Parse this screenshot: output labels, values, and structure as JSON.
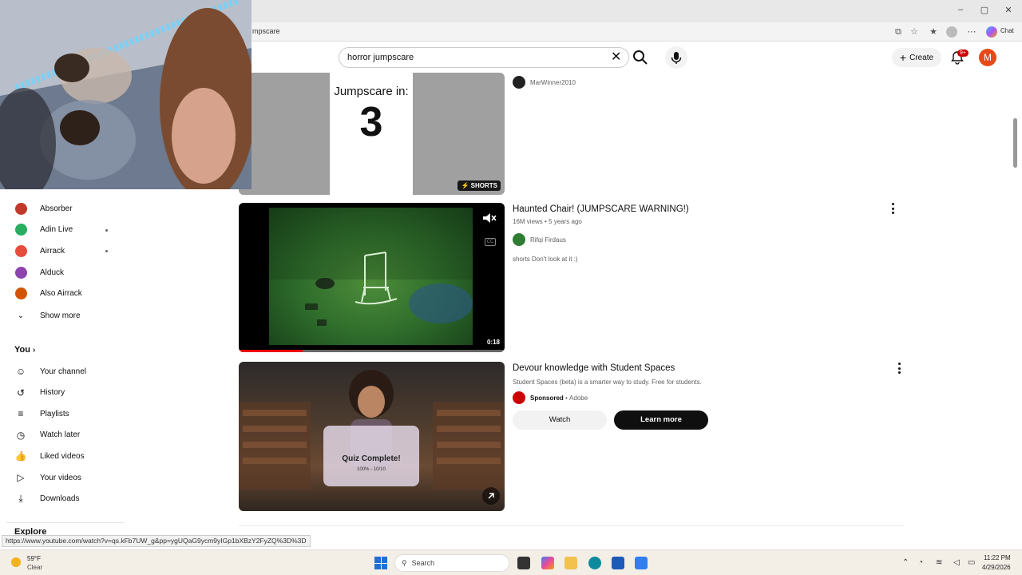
{
  "browser": {
    "url_fragment": "mpscare",
    "status_url": "https://www.youtube.com/watch?v=qs.kFb7UW_g&pp=ygUQaG9ycm9yIGp1bXBzY2FyZQ%3D%3D",
    "profile_label": "Chat"
  },
  "header": {
    "search_value": "horror jumpscare",
    "create_label": "Create",
    "notifications_badge": "9+",
    "avatar_letter": "M"
  },
  "sidebar": {
    "subscriptions": [
      {
        "name": "Absorber",
        "color": "#c0392b",
        "live": false
      },
      {
        "name": "Adin Live",
        "color": "#27ae60",
        "live": true
      },
      {
        "name": "Airrack",
        "color": "#e74c3c",
        "live": true
      },
      {
        "name": "Alduck",
        "color": "#8e44ad",
        "live": false
      },
      {
        "name": "Also Airrack",
        "color": "#d35400",
        "live": false
      }
    ],
    "show_more": "Show more",
    "you_heading": "You",
    "you_items": [
      {
        "label": "Your channel",
        "icon": "channel-icon"
      },
      {
        "label": "History",
        "icon": "history-icon"
      },
      {
        "label": "Playlists",
        "icon": "playlists-icon"
      },
      {
        "label": "Watch later",
        "icon": "watch-later-icon"
      },
      {
        "label": "Liked videos",
        "icon": "liked-icon"
      },
      {
        "label": "Your videos",
        "icon": "your-videos-icon"
      },
      {
        "label": "Downloads",
        "icon": "downloads-icon"
      }
    ],
    "explore_heading": "Explore"
  },
  "results": [
    {
      "channel": "MarWinner2010",
      "thumb_title": "Jumpscare in:",
      "thumb_count": "3",
      "badge": "SHORTS"
    },
    {
      "title": "Haunted Chair! (JUMPSCARE WARNING!)",
      "views": "16M views",
      "age": "5 years ago",
      "channel": "Rifqi Firdaus",
      "description": "shorts Don't look at it :)",
      "duration": "0:18",
      "progress": 0.24
    },
    {
      "title": "Devour knowledge with Student Spaces",
      "description": "Student Spaces (beta) is a smarter way to study. Free for students.",
      "sponsored": "Sponsored",
      "advertiser": "Adobe",
      "quiz_title": "Quiz Complete!",
      "quiz_score": "100% - 10/10",
      "watch_label": "Watch",
      "learn_label": "Learn more"
    }
  ],
  "taskbar": {
    "temp": "59°F",
    "condition": "Clear",
    "search_placeholder": "Search",
    "time": "11:22 PM",
    "date": "4/29/2026"
  },
  "colors": {
    "accent_red": "#cc0000",
    "brand_red": "#ff0000"
  }
}
